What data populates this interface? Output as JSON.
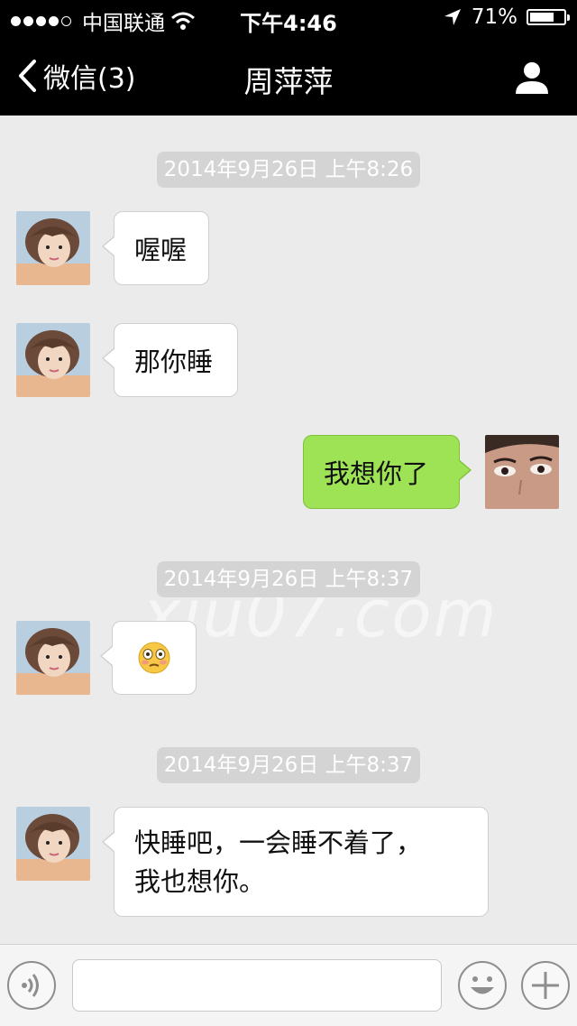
{
  "status_bar": {
    "carrier": "中国联通",
    "time": "下午4:46",
    "battery": "71%",
    "battery_level": 0.71
  },
  "nav": {
    "back_label": "微信(3)",
    "title": "周萍萍"
  },
  "messages": [
    {
      "type": "timestamp",
      "text": "2014年9月26日 上午8:26"
    },
    {
      "type": "incoming",
      "text": "喔喔"
    },
    {
      "type": "incoming",
      "text": "那你睡"
    },
    {
      "type": "outgoing",
      "text": "我想你了"
    },
    {
      "type": "timestamp",
      "text": "2014年9月26日 上午8:37"
    },
    {
      "type": "incoming",
      "text": "😳"
    },
    {
      "type": "timestamp",
      "text": "2014年9月26日 上午8:37"
    },
    {
      "type": "incoming",
      "lines": [
        "快睡吧，一会睡不着了，",
        "我也想你。"
      ]
    }
  ],
  "watermark": "xiu07.com",
  "input_bar": {
    "text_value": "",
    "voice_icon": "voice-icon",
    "emoji_icon": "emoji-icon",
    "plus_icon": "plus-icon"
  },
  "colors": {
    "outgoing_bubble": "#9de355",
    "incoming_bubble": "#ffffff",
    "nav_background": "#000000",
    "chat_background": "#ebebeb"
  }
}
